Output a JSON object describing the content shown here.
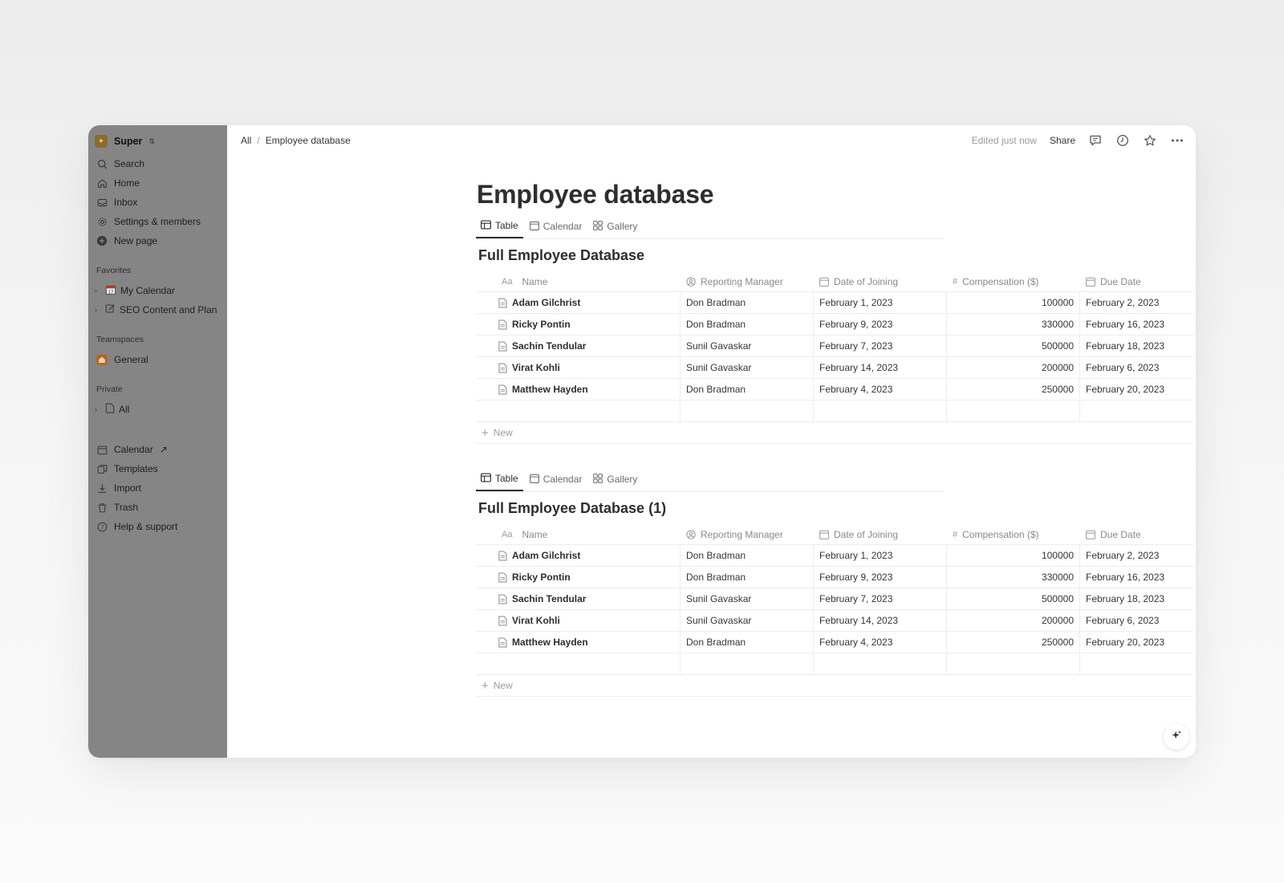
{
  "sidebar": {
    "workspace": {
      "name": "Super",
      "logo_glyph": "✦"
    },
    "nav": [
      {
        "label": "Search",
        "icon": "search-icon"
      },
      {
        "label": "Home",
        "icon": "home-icon"
      },
      {
        "label": "Inbox",
        "icon": "inbox-icon"
      },
      {
        "label": "Settings & members",
        "icon": "gear-icon"
      },
      {
        "label": "New page",
        "icon": "plus-circle-icon"
      }
    ],
    "favorites_label": "Favorites",
    "favorites": [
      {
        "label": "My Calendar",
        "icon": "calendar-emoji-icon"
      },
      {
        "label": "SEO Content and Plan",
        "icon": "edit-icon"
      }
    ],
    "teamspaces_label": "Teamspaces",
    "teamspaces": [
      {
        "label": "General",
        "icon": "house-icon"
      }
    ],
    "private_label": "Private",
    "private": [
      {
        "label": "All",
        "icon": "page-icon"
      }
    ],
    "bottom": [
      {
        "label": "Calendar",
        "icon": "calendar-icon",
        "suffix": "↗"
      },
      {
        "label": "Templates",
        "icon": "templates-icon"
      },
      {
        "label": "Import",
        "icon": "import-icon"
      },
      {
        "label": "Trash",
        "icon": "trash-icon"
      },
      {
        "label": "Help & support",
        "icon": "help-icon"
      }
    ]
  },
  "topbar": {
    "breadcrumb": [
      "All",
      "Employee database"
    ],
    "edited": "Edited just now",
    "share": "Share"
  },
  "page": {
    "title": "Employee database"
  },
  "views": [
    "Table",
    "Calendar",
    "Gallery"
  ],
  "columns": {
    "name": "Name",
    "name_prefix": "Aa",
    "manager": "Reporting Manager",
    "date": "Date of Joining",
    "comp": "Compensation ($)",
    "comp_prefix": "#",
    "due": "Due Date"
  },
  "new_label": "New",
  "databases": [
    {
      "title": "Full Employee Database",
      "rows": [
        {
          "name": "Adam Gilchrist",
          "manager": "Don Bradman",
          "date": "February 1, 2023",
          "comp": "100000",
          "due": "February 2, 2023"
        },
        {
          "name": "Ricky Pontin",
          "manager": "Don Bradman",
          "date": "February 9, 2023",
          "comp": "330000",
          "due": "February 16, 2023"
        },
        {
          "name": "Sachin Tendular",
          "manager": "Sunil Gavaskar",
          "date": "February 7, 2023",
          "comp": "500000",
          "due": "February 18, 2023"
        },
        {
          "name": "Virat Kohli",
          "manager": "Sunil Gavaskar",
          "date": "February 14, 2023",
          "comp": "200000",
          "due": "February 6, 2023"
        },
        {
          "name": "Matthew Hayden",
          "manager": "Don Bradman",
          "date": "February 4, 2023",
          "comp": "250000",
          "due": "February 20, 2023"
        }
      ]
    },
    {
      "title": "Full Employee Database (1)",
      "rows": [
        {
          "name": "Adam Gilchrist",
          "manager": "Don Bradman",
          "date": "February 1, 2023",
          "comp": "100000",
          "due": "February 2, 2023"
        },
        {
          "name": "Ricky Pontin",
          "manager": "Don Bradman",
          "date": "February 9, 2023",
          "comp": "330000",
          "due": "February 16, 2023"
        },
        {
          "name": "Sachin Tendular",
          "manager": "Sunil Gavaskar",
          "date": "February 7, 2023",
          "comp": "500000",
          "due": "February 18, 2023"
        },
        {
          "name": "Virat Kohli",
          "manager": "Sunil Gavaskar",
          "date": "February 14, 2023",
          "comp": "200000",
          "due": "February 6, 2023"
        },
        {
          "name": "Matthew Hayden",
          "manager": "Don Bradman",
          "date": "February 4, 2023",
          "comp": "250000",
          "due": "February 20, 2023"
        }
      ]
    }
  ]
}
